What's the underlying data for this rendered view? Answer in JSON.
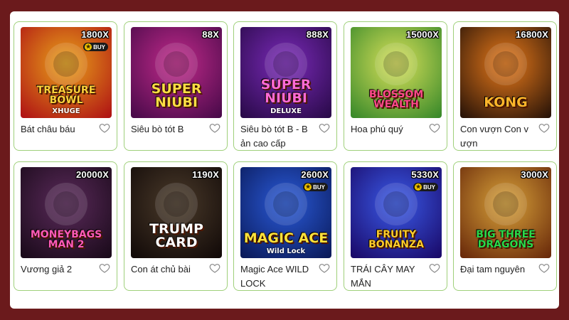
{
  "games": [
    {
      "name": "Bát châu báu",
      "multiplier": "1800X",
      "buy": "BUY",
      "logo": "TREASURE BOWL",
      "sub": "XHUGE",
      "colors": [
        "#e8a21a",
        "#b01414"
      ],
      "logo_color": "#ffd23a"
    },
    {
      "name": "Siêu bò tót B",
      "multiplier": "88X",
      "buy": "",
      "logo": "SUPER NIUBI",
      "sub": "",
      "colors": [
        "#c02a8a",
        "#4a0a4a"
      ],
      "logo_color": "#ffdd44"
    },
    {
      "name": "Siêu bò tót B - B ản cao cấp",
      "multiplier": "888X",
      "buy": "",
      "logo": "SUPER NIUBI",
      "sub": "DELUXE",
      "colors": [
        "#7a2ab8",
        "#2a0a4a"
      ],
      "logo_color": "#ff6ad5"
    },
    {
      "name": "Hoa phú quý",
      "multiplier": "15000X",
      "buy": "",
      "logo": "BLOSSOM WEALTH",
      "sub": "",
      "colors": [
        "#d8e05a",
        "#3a8a2a"
      ],
      "logo_color": "#ff4a8a"
    },
    {
      "name": "Con vượn Con v ượn",
      "multiplier": "16800X",
      "buy": "",
      "logo": "KONG",
      "sub": "",
      "colors": [
        "#e87a1a",
        "#2a1408"
      ],
      "logo_color": "#ffb62a"
    },
    {
      "name": "Vương giả 2",
      "multiplier": "20000X",
      "buy": "",
      "logo": "MONEYBAGS MAN 2",
      "sub": "",
      "colors": [
        "#5a2a5a",
        "#1a0a1a"
      ],
      "logo_color": "#ff5ab8"
    },
    {
      "name": "Con át chủ bài",
      "multiplier": "1190X",
      "buy": "",
      "logo": "TRUMP CARD",
      "sub": "",
      "colors": [
        "#4a3a2a",
        "#120a08"
      ],
      "logo_color": "#ffffff"
    },
    {
      "name": "Magic Ace WILD LOCK",
      "multiplier": "2600X",
      "buy": "BUY",
      "logo": "MAGIC ACE",
      "sub": "Wild Lock",
      "colors": [
        "#2a5ad8",
        "#0a1a5a"
      ],
      "logo_color": "#ffe23a"
    },
    {
      "name": "TRÁI CÂY MAY MẮN",
      "multiplier": "5330X",
      "buy": "BUY",
      "logo": "FRUITY BONANZA",
      "sub": "",
      "colors": [
        "#3a5ae8",
        "#1a0a6a"
      ],
      "logo_color": "#ffcc2a"
    },
    {
      "name": "Đại tam nguyên",
      "multiplier": "3000X",
      "buy": "",
      "logo": "BIG THREE DRAGONS",
      "sub": "",
      "colors": [
        "#d8a23a",
        "#6a2a0a"
      ],
      "logo_color": "#2ad84a"
    }
  ]
}
